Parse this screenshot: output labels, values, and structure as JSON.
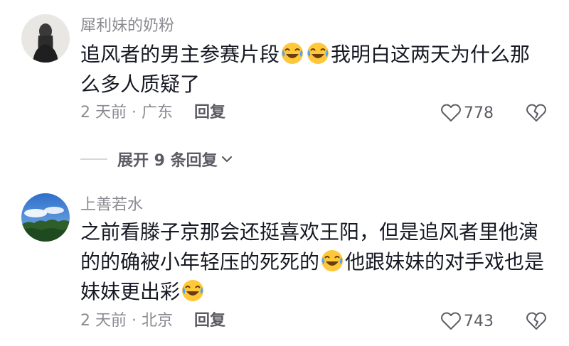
{
  "comments": [
    {
      "username": "犀利妹的奶粉",
      "text_a": "追风者的男主参赛片段",
      "emoji_a": "laugh-cry-emoji",
      "emoji_b": "laugh-cry-emoji",
      "text_b": "我明白这两天为什么那么多人质疑了",
      "time_location": "2 天前 · 广东",
      "reply_label": "回复",
      "likes": "778"
    },
    {
      "username": "上善若水",
      "text_a": "之前看滕子京那会还挺喜欢王阳，但是追风者里他演的的确被小年轻压的死死的",
      "emoji_a": "laugh-cry-emoji",
      "text_b": "他跟妹妹的对手戏也是妹妹更出彩",
      "emoji_b": "laugh-cry-emoji",
      "time_location": "2 天前 · 北京",
      "reply_label": "回复",
      "likes": "743"
    }
  ],
  "expand_replies": {
    "label": "展开 9 条回复"
  },
  "colors": {
    "primary_text": "#161823",
    "secondary_text": "#8a8b91",
    "action_text": "#5b5c63",
    "emoji_face": "#ffc83a",
    "emoji_tear": "#4da6ff"
  }
}
